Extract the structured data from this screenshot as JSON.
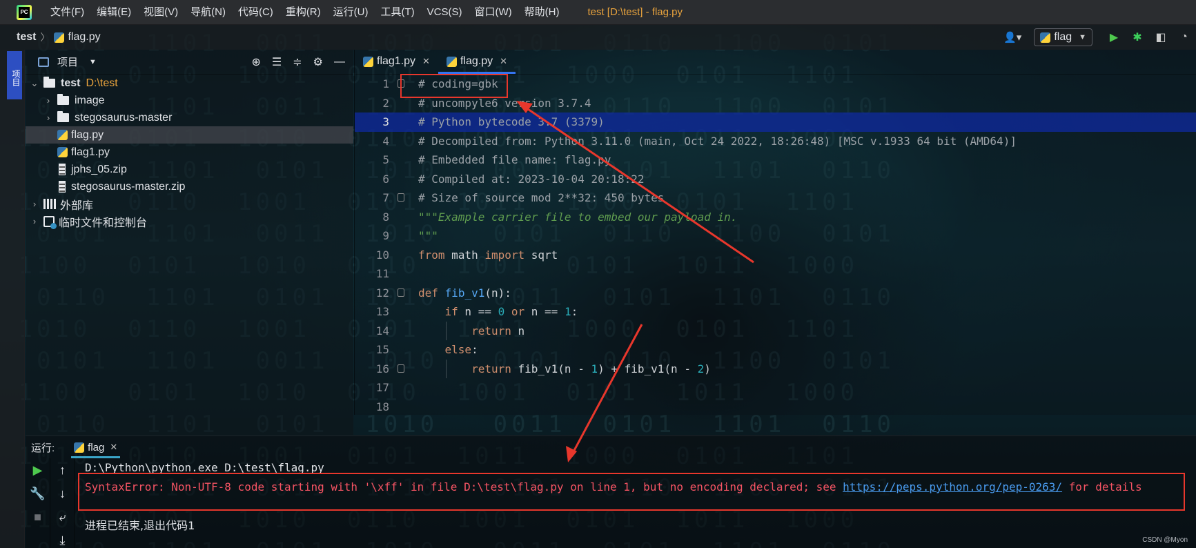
{
  "menubar": {
    "items": [
      "文件(F)",
      "编辑(E)",
      "视图(V)",
      "导航(N)",
      "代码(C)",
      "重构(R)",
      "运行(U)",
      "工具(T)",
      "VCS(S)",
      "窗口(W)",
      "帮助(H)"
    ],
    "window_title": "test [D:\\test] - flag.py"
  },
  "navbar": {
    "project": "test",
    "file": "flag.py",
    "run_config": "flag"
  },
  "left_stripe": {
    "tab_label": "项目"
  },
  "project_panel": {
    "title": "项目",
    "tree": [
      {
        "label": "test",
        "hint": "D:\\test",
        "type": "root"
      },
      {
        "label": "image",
        "type": "folder"
      },
      {
        "label": "stegosaurus-master",
        "type": "folder"
      },
      {
        "label": "flag.py",
        "type": "py",
        "selected": true
      },
      {
        "label": "flag1.py",
        "type": "py"
      },
      {
        "label": "jphs_05.zip",
        "type": "zip"
      },
      {
        "label": "stegosaurus-master.zip",
        "type": "zip"
      },
      {
        "label": "外部库",
        "type": "lib"
      },
      {
        "label": "临时文件和控制台",
        "type": "scratch"
      }
    ]
  },
  "editor": {
    "tabs": [
      {
        "label": "flag1.py",
        "active": false
      },
      {
        "label": "flag.py",
        "active": true
      }
    ],
    "line_numbers": [
      "1",
      "2",
      "3",
      "4",
      "5",
      "6",
      "7",
      "8",
      "9",
      "10",
      "11",
      "12",
      "13",
      "14",
      "15",
      "16",
      "17",
      "18"
    ],
    "current_line": "3",
    "lines": {
      "l1": "# coding=gbk",
      "l2": "# uncompyle6 version 3.7.4",
      "l3": "# Python bytecode 3.7 (3379)",
      "l4": "# Decompiled from: Python 3.11.0 (main, Oct 24 2022, 18:26:48) [MSC v.1933 64 bit (AMD64)]",
      "l5": "# Embedded file name: flag.py",
      "l6": "# Compiled at: 2023-10-04 20:18:22",
      "l7": "# Size of source mod 2**32: 450 bytes",
      "l8": "\"\"\"Example carrier file to embed our payload in.",
      "l9": "\"\"\"",
      "l10_kw1": "from",
      "l10_mod": " math ",
      "l10_kw2": "import",
      "l10_name": " sqrt",
      "l12_kw": "def",
      "l12_fn": "fib_v1",
      "l12_rest": "(n):",
      "l13_kw": "if",
      "l13_a": " n == ",
      "l13_n0": "0",
      "l13_or": " or",
      "l13_b": " n == ",
      "l13_n1": "1",
      "l13_c": ":",
      "l14_kw": "return",
      "l14_rest": " n",
      "l15_kw": "else",
      "l15_rest": ":",
      "l16_kw": "return",
      "l16_a": " fib_v1(n - ",
      "l16_n1": "1",
      "l16_b": ") + fib_v1(n - ",
      "l16_n2": "2",
      "l16_c": ")"
    }
  },
  "run_panel": {
    "label": "运行:",
    "tab": "flag",
    "console": {
      "cmd": "D:\\Python\\python.exe D:\\test\\flag.py",
      "error_prefix": "SyntaxError: Non-UTF-8 code starting with '\\xff' in file D:\\test\\flag.py on line 1, but no encoding declared; see ",
      "error_link": "https://peps.python.org/pep-0263/",
      "error_suffix": " for details",
      "exit": "进程已结束,退出代码1"
    }
  },
  "watermark": "CSDN @Myon⁠",
  "colors": {
    "annotation_red": "#e8372c",
    "caret_line": "#0f2aa0",
    "error_text": "#f75464",
    "link": "#4a9cf0",
    "keyword": "#cf8e6d",
    "number": "#2aacb8",
    "docstring": "#5f9c4f",
    "title_orange": "#e8a33d"
  },
  "icons": [
    "app-logo-icon",
    "python-file-icon",
    "folder-icon",
    "zip-icon",
    "library-icon",
    "scratch-icon",
    "run-icon",
    "debug-icon",
    "coverage-icon",
    "user-icon",
    "target-icon",
    "expand-all-icon",
    "collapse-all-icon",
    "gear-icon",
    "minimize-icon",
    "rerun-icon",
    "wrench-icon",
    "stop-icon",
    "up-arrow-icon",
    "down-arrow-icon",
    "soft-wrap-icon",
    "scroll-end-icon"
  ]
}
